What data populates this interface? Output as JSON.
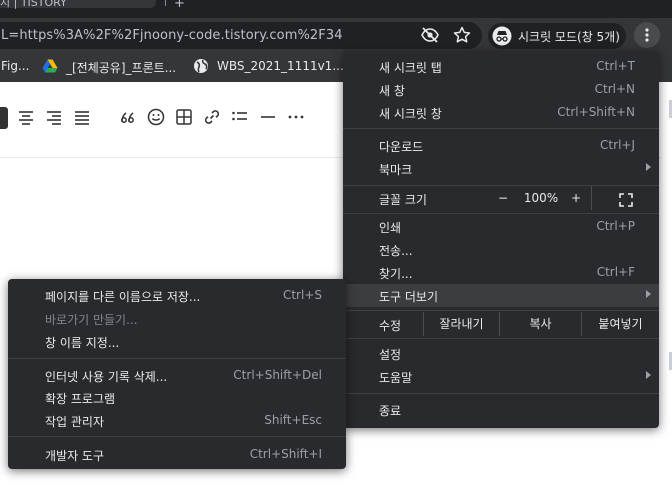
{
  "tab": {
    "title": "지 | TISTORY"
  },
  "omnibox": {
    "url": "L=https%3A%2F%2Fjnoony-code.tistory.com%2F34"
  },
  "incognito": {
    "label": "시크릿 모드(창 5개)"
  },
  "bookmarks": [
    {
      "label": "Fig...",
      "icon": "figma-icon"
    },
    {
      "label": "_[전체공유]_프론트...",
      "icon": "google-drive-icon"
    },
    {
      "label": "WBS_2021_1111v1....",
      "icon": "globe-icon"
    }
  ],
  "main_menu": {
    "group1": [
      {
        "label": "새 시크릿 탭",
        "shortcut": "Ctrl+T"
      },
      {
        "label": "새 창",
        "shortcut": "Ctrl+N"
      },
      {
        "label": "새 시크릿 창",
        "shortcut": "Ctrl+Shift+N"
      }
    ],
    "group2": [
      {
        "label": "다운로드",
        "shortcut": "Ctrl+J"
      },
      {
        "label": "북마크",
        "shortcut": ""
      }
    ],
    "zoom": {
      "label": "글꼴 크기",
      "minus": "−",
      "value": "100%",
      "plus": "+"
    },
    "group3": [
      {
        "label": "인쇄",
        "shortcut": "Ctrl+P"
      },
      {
        "label": "전송...",
        "shortcut": ""
      },
      {
        "label": "찾기...",
        "shortcut": "Ctrl+F"
      },
      {
        "label": "도구 더보기",
        "shortcut": ""
      }
    ],
    "edit": {
      "label": "수정",
      "cut": "잘라내기",
      "copy": "복사",
      "paste": "붙여넣기"
    },
    "group4": [
      {
        "label": "설정",
        "shortcut": ""
      },
      {
        "label": "도움말",
        "shortcut": ""
      }
    ],
    "group5": [
      {
        "label": "종료",
        "shortcut": ""
      }
    ]
  },
  "sub_menu": {
    "group1": [
      {
        "label": "페이지를 다른 이름으로 저장...",
        "shortcut": "Ctrl+S"
      },
      {
        "label": "바로가기 만들기...",
        "shortcut": ""
      },
      {
        "label": "창 이름 지정...",
        "shortcut": ""
      }
    ],
    "group2": [
      {
        "label": "인터넷 사용 기록 삭제...",
        "shortcut": "Ctrl+Shift+Del"
      },
      {
        "label": "확장 프로그램",
        "shortcut": ""
      },
      {
        "label": "작업 관리자",
        "shortcut": "Shift+Esc"
      }
    ],
    "group3": [
      {
        "label": "개발자 도구",
        "shortcut": "Ctrl+Shift+I"
      }
    ]
  },
  "editor_tools": [
    "align-left-icon",
    "align-center-icon",
    "align-right-icon",
    "align-justify-icon",
    "quote-icon",
    "emoji-icon",
    "table-icon",
    "link-icon",
    "bullet-list-icon",
    "horizontal-rule-icon",
    "more-icon"
  ],
  "colors": {
    "menu_bg": "#292a2d",
    "menu_highlight": "#3c3d41",
    "toolbar_bg": "#35363a",
    "omnibox_bg": "#202124"
  }
}
